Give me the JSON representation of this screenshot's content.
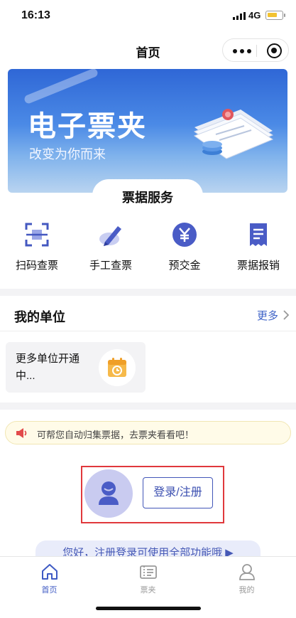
{
  "status_bar": {
    "time": "16:13",
    "network": "4G"
  },
  "nav": {
    "title": "首页"
  },
  "banner": {
    "title": "电子票夹",
    "subtitle": "改变为你而来"
  },
  "services": {
    "title": "票据服务",
    "items": [
      {
        "label": "扫码查票",
        "icon": "scan-icon"
      },
      {
        "label": "手工查票",
        "icon": "pen-icon"
      },
      {
        "label": "预交金",
        "icon": "yuan-icon"
      },
      {
        "label": "票据报销",
        "icon": "receipt-icon"
      }
    ]
  },
  "my_unit": {
    "title": "我的单位",
    "more": "更多",
    "card_text": "更多单位开通中..."
  },
  "notice": {
    "text": "可帮您自动归集票据，去票夹看看吧！"
  },
  "login": {
    "button": "登录/注册"
  },
  "promo": {
    "text": "您好，注册登录可使用全部功能哦 ▶"
  },
  "tabbar": {
    "items": [
      {
        "label": "首页",
        "icon": "home-icon",
        "active": true
      },
      {
        "label": "票夹",
        "icon": "ticket-folder-icon",
        "active": false
      },
      {
        "label": "我的",
        "icon": "user-icon",
        "active": false
      }
    ]
  },
  "colors": {
    "primary": "#3f5bc4",
    "highlight_border": "#e0383c",
    "notice_bg": "#fffbe8"
  }
}
